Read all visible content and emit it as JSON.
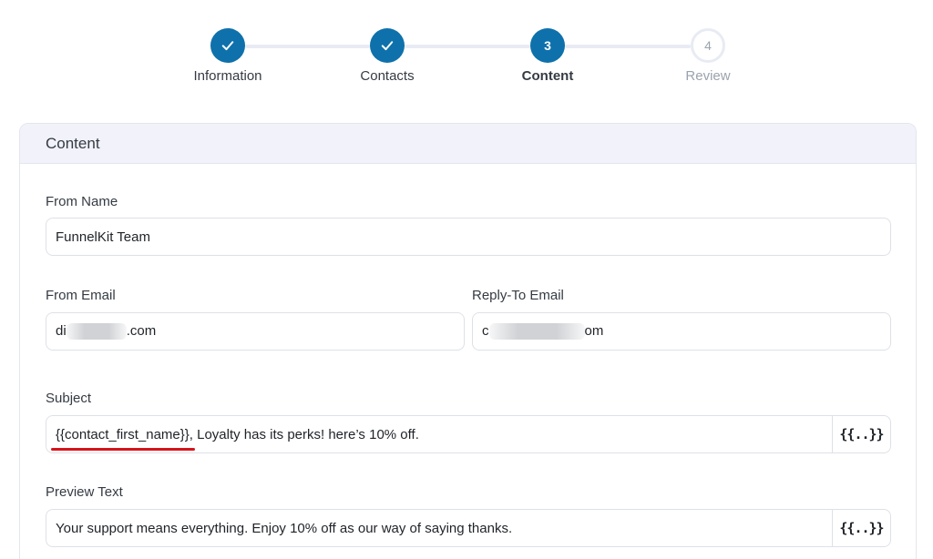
{
  "stepper": {
    "steps": [
      {
        "label": "Information",
        "state": "done",
        "icon": "check-icon"
      },
      {
        "label": "Contacts",
        "state": "done",
        "icon": "check-icon"
      },
      {
        "label": "Content",
        "state": "active",
        "number": "3"
      },
      {
        "label": "Review",
        "state": "pending",
        "number": "4"
      }
    ]
  },
  "colors": {
    "accent": "#0e71ab",
    "track": "#e8ebf3",
    "annotation": "#d6141b"
  },
  "card": {
    "title": "Content"
  },
  "form": {
    "from_name": {
      "label": "From Name",
      "value": "FunnelKit Team"
    },
    "from_email": {
      "label": "From Email",
      "value_prefix": "di",
      "value_suffix": ".com"
    },
    "reply_to": {
      "label": "Reply-To Email",
      "value_prefix": "c",
      "value_suffix": "om"
    },
    "subject": {
      "label": "Subject",
      "merge_tag": "{{contact_first_name}}",
      "value_rest": ", Loyalty has its perks! here’s 10% off.",
      "merge_button": "{{..}}"
    },
    "preview_text": {
      "label": "Preview Text",
      "value": "Your support means everything. Enjoy 10% off as our way of saying thanks.",
      "merge_button": "{{..}}"
    }
  }
}
